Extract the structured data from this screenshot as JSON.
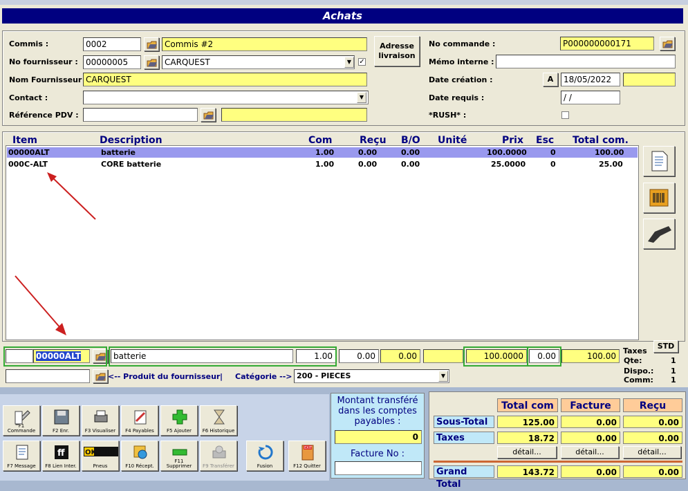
{
  "title": "Achats",
  "header": {
    "commis_label": "Commis :",
    "commis_code": "0002",
    "commis_name": "Commis #2",
    "fournisseur_label": "No fournisseur :",
    "fournisseur_code": "00000005",
    "fournisseur_name": "CARQUEST",
    "nom_fournisseur_label": "Nom Fournisseur :",
    "nom_fournisseur": "CARQUEST",
    "contact_label": "Contact :",
    "contact_value": "",
    "ref_pdv_label": "Référence PDV :",
    "adresse_btn": "Adresse livraison",
    "no_commande_label": "No commande :",
    "no_commande": "P000000000171",
    "memo_label": "Mémo interne :",
    "memo_value": "",
    "date_creation_label": "Date création :",
    "date_a_btn": "A",
    "date_creation": "18/05/2022",
    "date_requis_label": "Date requis :",
    "date_requis": "/ /",
    "rush_label": "*RUSH* :"
  },
  "table": {
    "columns": [
      "Item",
      "Description",
      "Com",
      "Reçu",
      "B/O",
      "Unité",
      "Prix",
      "Esc",
      "Total com."
    ],
    "rows": [
      {
        "item": "00000ALT",
        "desc": "batterie",
        "com": "1.00",
        "recu": "0.00",
        "bo": "0.00",
        "unite": "",
        "prix": "100.0000",
        "esc": "0",
        "total": "100.00"
      },
      {
        "item": "000C-ALT",
        "desc": "CORE batterie",
        "com": "1.00",
        "recu": "0.00",
        "bo": "0.00",
        "unite": "",
        "prix": "25.0000",
        "esc": "0",
        "total": "25.00"
      }
    ]
  },
  "edit_line": {
    "item": "00000ALT",
    "desc": "batterie",
    "com": "1.00",
    "recu": "0.00",
    "bo": "0.00",
    "prix": "100.0000",
    "esc": "0.00",
    "total": "100.00",
    "taxes_label": "Taxes",
    "std_btn": "STD",
    "qte_label": "Qte:",
    "qte_value": "1",
    "dispo_label": "Dispo.:",
    "dispo_value": "1",
    "comm_label": "Comm:",
    "comm_value": "1",
    "produit_label": "<-- Produit du fournisseur",
    "sep": "|",
    "categorie_label": "Catégorie -->",
    "categorie_value": "200 - PIECES"
  },
  "toolbar": {
    "row1": [
      {
        "key": "F1",
        "label": "Commande"
      },
      {
        "key": "F2",
        "label": "F2 Enr."
      },
      {
        "key": "F3",
        "label": "F3 Visualiser"
      },
      {
        "key": "F4",
        "label": "F4 Payables"
      },
      {
        "key": "F5",
        "label": "F5 Ajouter"
      },
      {
        "key": "F6",
        "label": "F6 Historique"
      }
    ],
    "row2": [
      {
        "label": "F7 Message"
      },
      {
        "label": "F8 Lien Inter."
      },
      {
        "label": "Pneus"
      },
      {
        "label": "F10 Récept."
      },
      {
        "label": "Supprimer"
      },
      {
        "label": "F9 Transférer"
      },
      {
        "label": "Fusion"
      },
      {
        "label": "F12 Quitter"
      }
    ],
    "f1_key": "F1",
    "f11_key": "F11",
    "oktire_logo": "OK TIRE",
    "exit_logo": "EXIT"
  },
  "transfer": {
    "label": "Montant transféré dans les comptes payables :",
    "value": "0",
    "facture_label": "Facture No :",
    "facture_value": ""
  },
  "totals": {
    "headers": [
      "Total com",
      "Facture",
      "Reçu"
    ],
    "sous_total_label": "Sous-Total",
    "sous_total": [
      "125.00",
      "0.00",
      "0.00"
    ],
    "taxes_label": "Taxes",
    "taxes": [
      "18.72",
      "0.00",
      "0.00"
    ],
    "detail_btn": "détail...",
    "grand_total_label": "Grand Total",
    "grand_total": [
      "143.72",
      "0.00",
      "0.00"
    ]
  },
  "colors": {
    "title_bar": "#000080",
    "highlight": "#ffff80",
    "selected_row": "#9999ee",
    "green_outline": "#33aa33"
  }
}
